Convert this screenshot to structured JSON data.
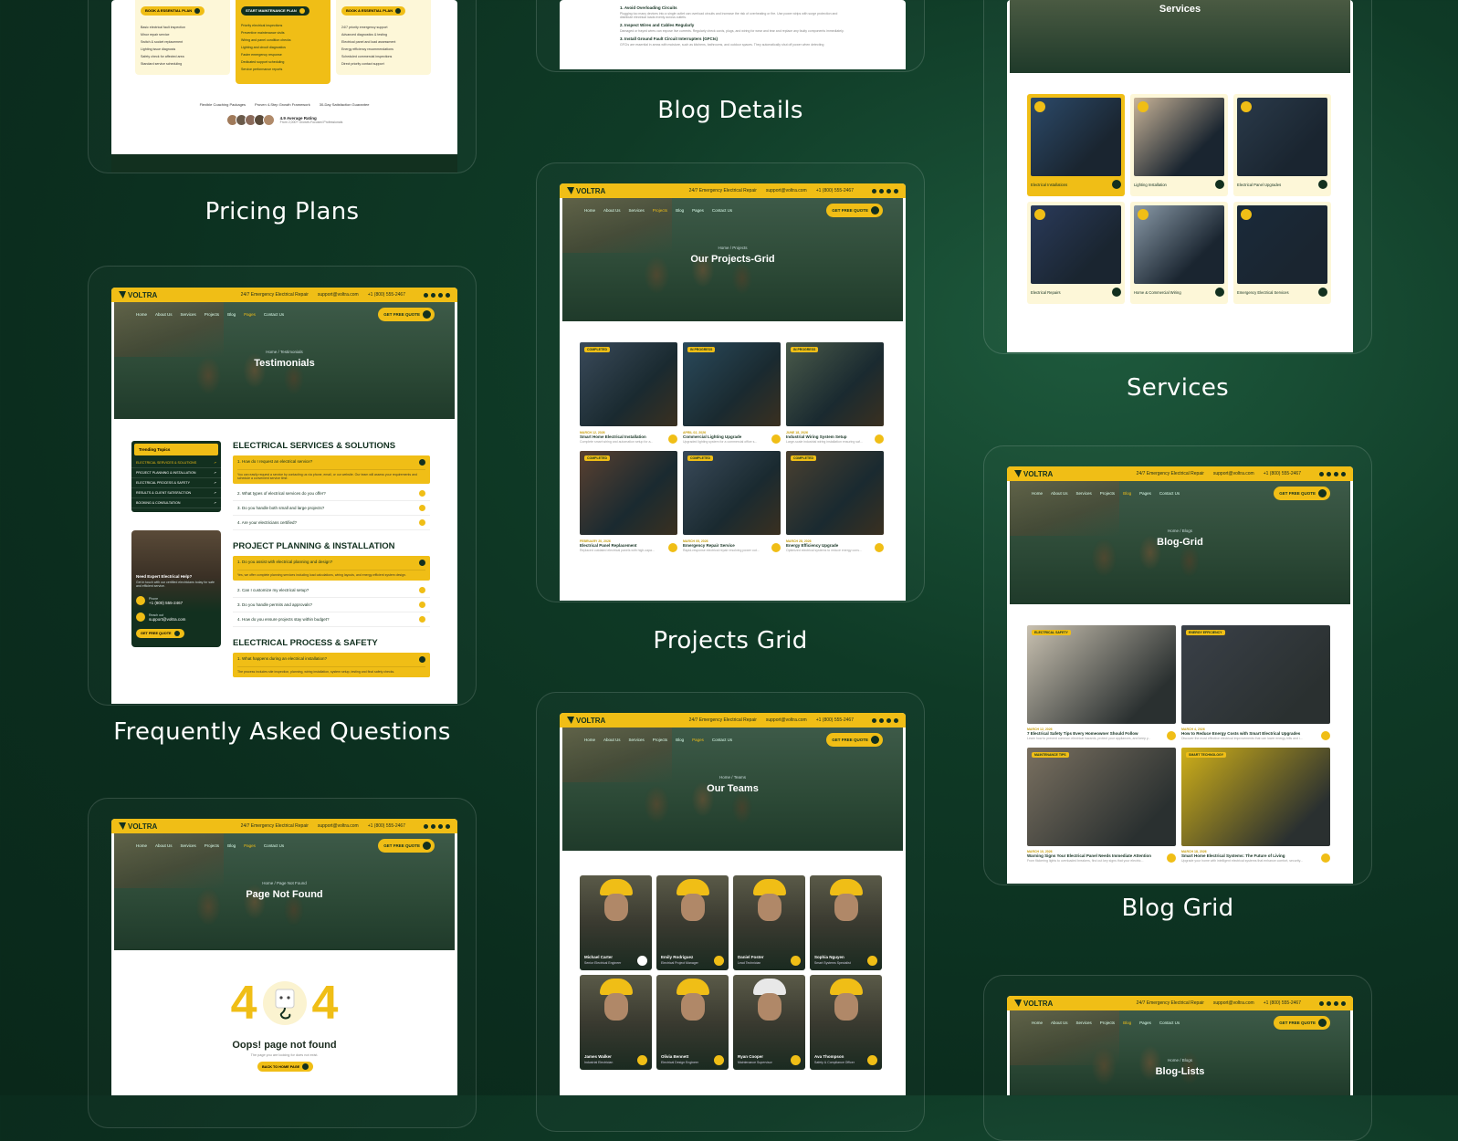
{
  "captions": {
    "pricing": "Pricing Plans",
    "faq": "Frequently Asked Questions",
    "blog_details": "Blog Details",
    "projects": "Projects Grid",
    "services": "Services",
    "blog_grid": "Blog Grid"
  },
  "header": {
    "brand": "VOLTRA",
    "emergency": "24/7 Emergency Electrical Repair",
    "email": "support@voltra.com",
    "phone": "+1 (800) 555-2467",
    "nav": [
      "Home",
      "About Us",
      "Services",
      "Projects",
      "Blog",
      "Pages",
      "Contact Us"
    ],
    "cta": "GET FREE QUOTE"
  },
  "pricing": {
    "buttons": [
      "BOOK A ESSENTIAL PLAN",
      "START MAINTENANCE PLAN",
      "BOOK A ESSENTIAL PLAN"
    ],
    "col1": [
      "Basic electrical fault inspection",
      "Minor repair service",
      "Switch & socket replacement",
      "Lighting issue diagnosis",
      "Safety check for affected area",
      "Standard service scheduling"
    ],
    "col2": [
      "Priority electrical inspections",
      "Preventive maintenance visits",
      "Wiring and panel condition checks",
      "Lighting and circuit diagnostics",
      "Faster emergency response",
      "Dedicated support scheduling",
      "Service performance reports"
    ],
    "col3": [
      "24/7 priority emergency support",
      "Advanced diagnostics & testing",
      "Electrical panel and load assessment",
      "Energy efficiency recommendations",
      "Scheduled commercial inspections",
      "Direct priority contact support"
    ],
    "features": [
      "Flexible Coaching Packages",
      "Proven 4-Step Growth Framework",
      "30-Day Satisfaction Guarantee"
    ],
    "rating": "4.9 Average Rating",
    "rating_sub": "From 2,000+ Growth-Focused Professionals"
  },
  "faq": {
    "crumb": "Home / Testimonials",
    "title": "Testimonials",
    "topics_title": "Trending Topics",
    "topics": [
      "ELECTRICAL SERVICES & SOLUTIONS",
      "PROJECT PLANNING & INSTALLATION",
      "ELECTRICAL PROCESS & SAFETY",
      "RESULTS & CLIENT SATISFACTION",
      "BOOKING & CONSULTATION"
    ],
    "help_title": "Need Expert Electrical Help?",
    "help_text": "Get in touch with our certified electricians today for safe and efficient service.",
    "phone_label": "Phone",
    "phone": "+1 (800) 555-2467",
    "email_label": "Reach out",
    "email": "support@voltra.com",
    "help_cta": "GET FREE QUOTE",
    "sections": [
      {
        "heading": "ELECTRICAL SERVICES & SOLUTIONS",
        "open_q": "1. How do I request an electrical service?",
        "open_a": "You can easily request a service by contacting us via phone, email, or our website. Our team will assess your requirements and schedule a convenient service time.",
        "qs": [
          "2. What types of electrical services do you offer?",
          "3. Do you handle both small and large projects?",
          "4. Are your electricians certified?"
        ]
      },
      {
        "heading": "PROJECT PLANNING & INSTALLATION",
        "open_q": "1. Do you assist with electrical planning and design?",
        "open_a": "Yes, we offer complete planning services including load calculations, wiring layouts, and energy-efficient system design.",
        "qs": [
          "2. Can I customize my electrical setup?",
          "3. Do you handle permits and approvals?",
          "4. How do you ensure projects stay within budget?"
        ]
      },
      {
        "heading": "ELECTRICAL PROCESS & SAFETY",
        "open_q": "1. What happens during an electrical installation?",
        "open_a": "The process includes site inspection, planning, wiring installation, system setup, testing and final safety checks.",
        "qs": []
      }
    ]
  },
  "notfound": {
    "crumb": "Home / Page Not Found",
    "title": "Page Not Found",
    "code_left": "4",
    "code_right": "4",
    "message": "Oops! page not found",
    "sub": "The page you are looking for does not exist.",
    "button": "BACK TO HOME PAGE"
  },
  "blog_details": {
    "h1": "1. Avoid Overloading Circuits",
    "p1": "Plugging too many devices into a single outlet can overload circuits and increase the risk of overheating or fire. Use power strips with surge protection and distribute electrical loads evenly across outlets.",
    "h2": "2. Inspect Wires and Cables Regularly",
    "p2": "Damaged or frayed wires can expose live currents. Regularly check cords, plugs, and wiring for wear and tear and replace any faulty components immediately.",
    "h3": "3. Install Ground Fault Circuit Interrupters (GFCIs)",
    "p3": "GFCIs are essential in areas with moisture, such as kitchens, bathrooms, and outdoor spaces. They automatically shut off power when detecting"
  },
  "projects": {
    "crumb": "Home / Projects",
    "title": "Our Projects-Grid",
    "items": [
      {
        "tag": "COMPLETED",
        "date": "MARCH 12, 2026",
        "name": "Smart Home Electrical Installation",
        "desc": "Complete smart wiring and automation setup for a..."
      },
      {
        "tag": "IN PROGRESS",
        "date": "APRIL 02, 2026",
        "name": "Commercial Lighting Upgrade",
        "desc": "Upgraded lighting system for a commercial office s..."
      },
      {
        "tag": "IN PROGRESS",
        "date": "JUNE 18, 2026",
        "name": "Industrial Wiring System Setup",
        "desc": "Large-scale industrial wiring installation ensuring saf..."
      },
      {
        "tag": "COMPLETED",
        "date": "FEBRUARY 20, 2026",
        "name": "Electrical Panel Replacement",
        "desc": "Replaced outdated electrical panels with high-capa..."
      },
      {
        "tag": "COMPLETED",
        "date": "MARCH 05, 2026",
        "name": "Emergency Repair Service",
        "desc": "Rapid-response electrical repair resolving power out..."
      },
      {
        "tag": "COMPLETED",
        "date": "MARCH 28, 2026",
        "name": "Energy Efficiency Upgrade",
        "desc": "Optimized electrical systems to reduce energy cons..."
      }
    ]
  },
  "teams": {
    "crumb": "Home / Teams",
    "title": "Our Teams",
    "members": [
      {
        "name": "Michael Carter",
        "role": "Senior Electrical Engineer"
      },
      {
        "name": "Emily Rodriguez",
        "role": "Electrical Project Manager"
      },
      {
        "name": "Daniel Foster",
        "role": "Lead Technician"
      },
      {
        "name": "Sophia Nguyen",
        "role": "Smart Systems Specialist"
      },
      {
        "name": "James Walker",
        "role": "Industrial Electrician"
      },
      {
        "name": "Olivia Bennett",
        "role": "Electrical Design Engineer"
      },
      {
        "name": "Ryan Cooper",
        "role": "Maintenance Supervisor"
      },
      {
        "name": "Ava Thompson",
        "role": "Safety & Compliance Officer"
      }
    ]
  },
  "services": {
    "title": "Services",
    "items": [
      "Electrical Installations",
      "Lighting Installation",
      "Electrical Panel Upgrades",
      "Electrical Repairs",
      "Home & Commercial Wiring",
      "Emergency Electrical Services"
    ]
  },
  "blog_grid": {
    "crumb": "Home / Blogs",
    "title": "Blog-Grid",
    "posts": [
      {
        "tag": "ELECTRICAL SAFETY",
        "date": "MARCH 12, 2026",
        "title": "7 Electrical Safety Tips Every Homeowner Should Follow",
        "desc": "Learn how to prevent common electrical hazards, protect your appliances, and keep y..."
      },
      {
        "tag": "ENERGY EFFICIENCY",
        "date": "MARCH 4, 2026",
        "title": "How to Reduce Energy Costs with Smart Electrical Upgrades",
        "desc": "Discover the most effective electrical improvements that can lower energy bills and i..."
      },
      {
        "tag": "MAINTENANCE TIPS",
        "date": "MARCH 10, 2026",
        "title": "Warning Signs Your Electrical Panel Needs Immediate Attention",
        "desc": "From flickering lights to overloaded breakers, find out key signs that your electric..."
      },
      {
        "tag": "SMART TECHNOLOGY",
        "date": "MARCH 18, 2026",
        "title": "Smart Home Electrical Systems: The Future of Living",
        "desc": "Upgrade your home with intelligent electrical systems that enhance comfort, security..."
      }
    ]
  },
  "blog_list": {
    "crumb": "Home / Blogs",
    "title": "Blog-Lists"
  },
  "colors": {
    "accent": "#f0be16",
    "dark_green": "#12301f",
    "background": "#0f3a26"
  }
}
